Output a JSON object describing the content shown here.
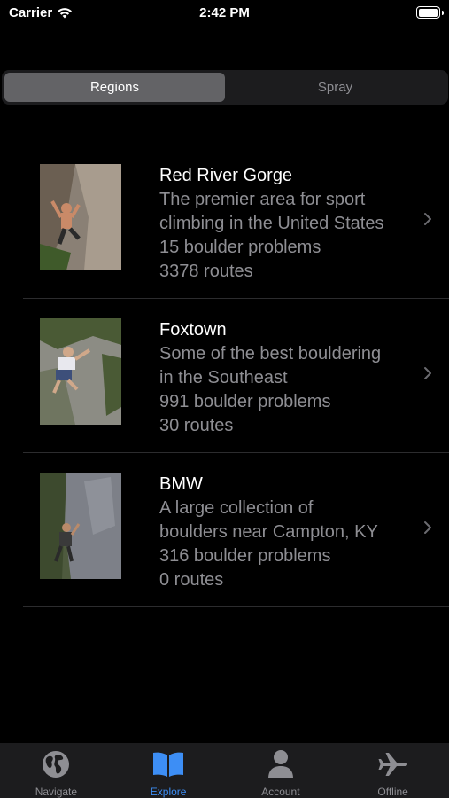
{
  "status_bar": {
    "carrier": "Carrier",
    "time": "2:42 PM"
  },
  "segmented_control": {
    "segments": [
      {
        "label": "Regions",
        "selected": true
      },
      {
        "label": "Spray",
        "selected": false
      }
    ]
  },
  "regions": [
    {
      "name": "Red River Gorge",
      "description_line1": "The premier area for sport",
      "description_line2": "climbing in the United States",
      "boulder_problems": "15 boulder problems",
      "routes": "3378 routes",
      "thumbnail_icon": "climber-photo-overhang"
    },
    {
      "name": "Foxtown",
      "description_line1": "Some of the best bouldering",
      "description_line2": "in the Southeast",
      "boulder_problems": "991 boulder problems",
      "routes": "30 routes",
      "thumbnail_icon": "climber-photo-boulder"
    },
    {
      "name": "BMW",
      "description_line1": "A large collection of",
      "description_line2": "boulders near Campton, KY",
      "boulder_problems": "316 boulder problems",
      "routes": "0 routes",
      "thumbnail_icon": "climber-photo-wall"
    }
  ],
  "tab_bar": {
    "tabs": [
      {
        "label": "Navigate",
        "icon": "globe-icon",
        "selected": false
      },
      {
        "label": "Explore",
        "icon": "book-icon",
        "selected": true
      },
      {
        "label": "Account",
        "icon": "person-icon",
        "selected": false
      },
      {
        "label": "Offline",
        "icon": "airplane-icon",
        "selected": false
      }
    ]
  },
  "colors": {
    "accent": "#3d8ef5",
    "background": "#000000",
    "secondary_text": "#8e8e93",
    "tab_bar_bg": "#1c1c1e"
  }
}
